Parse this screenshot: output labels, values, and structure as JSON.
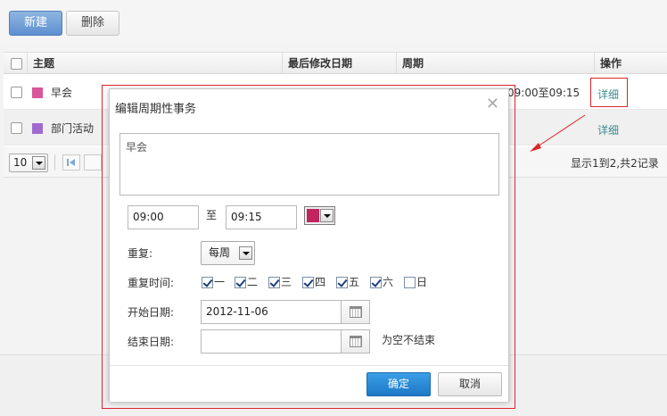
{
  "toolbar": {
    "new_label": "新建",
    "delete_label": "删除"
  },
  "grid": {
    "columns": {
      "subject": "主题",
      "modified": "最后修改日期",
      "cycle": "周期",
      "action": "操作"
    },
    "rows": [
      {
        "color": "#d9569a",
        "subject": "早会",
        "cycle": "09:00至09:15",
        "action": "详细"
      },
      {
        "color": "#a06ad1",
        "subject": "部门活动",
        "action": "详细"
      }
    ],
    "pager": {
      "page_size": "10",
      "summary": "显示1到2,共2记录"
    }
  },
  "dialog": {
    "title": "编辑周期性事务",
    "content": "早会",
    "start_time": "09:00",
    "to_label": "至",
    "end_time": "09:15",
    "color": "#c2245e",
    "repeat_label": "重复:",
    "repeat_value": "每周",
    "repeat_time_label": "重复时间:",
    "days": [
      {
        "label": "一",
        "checked": true
      },
      {
        "label": "二",
        "checked": true
      },
      {
        "label": "三",
        "checked": true
      },
      {
        "label": "四",
        "checked": true
      },
      {
        "label": "五",
        "checked": true
      },
      {
        "label": "六",
        "checked": true
      },
      {
        "label": "日",
        "checked": false
      }
    ],
    "start_date_label": "开始日期:",
    "start_date": "2012-11-06",
    "end_date_label": "结束日期:",
    "end_date": "",
    "empty_hint": "为空不结束",
    "ok_label": "确定",
    "cancel_label": "取消"
  }
}
